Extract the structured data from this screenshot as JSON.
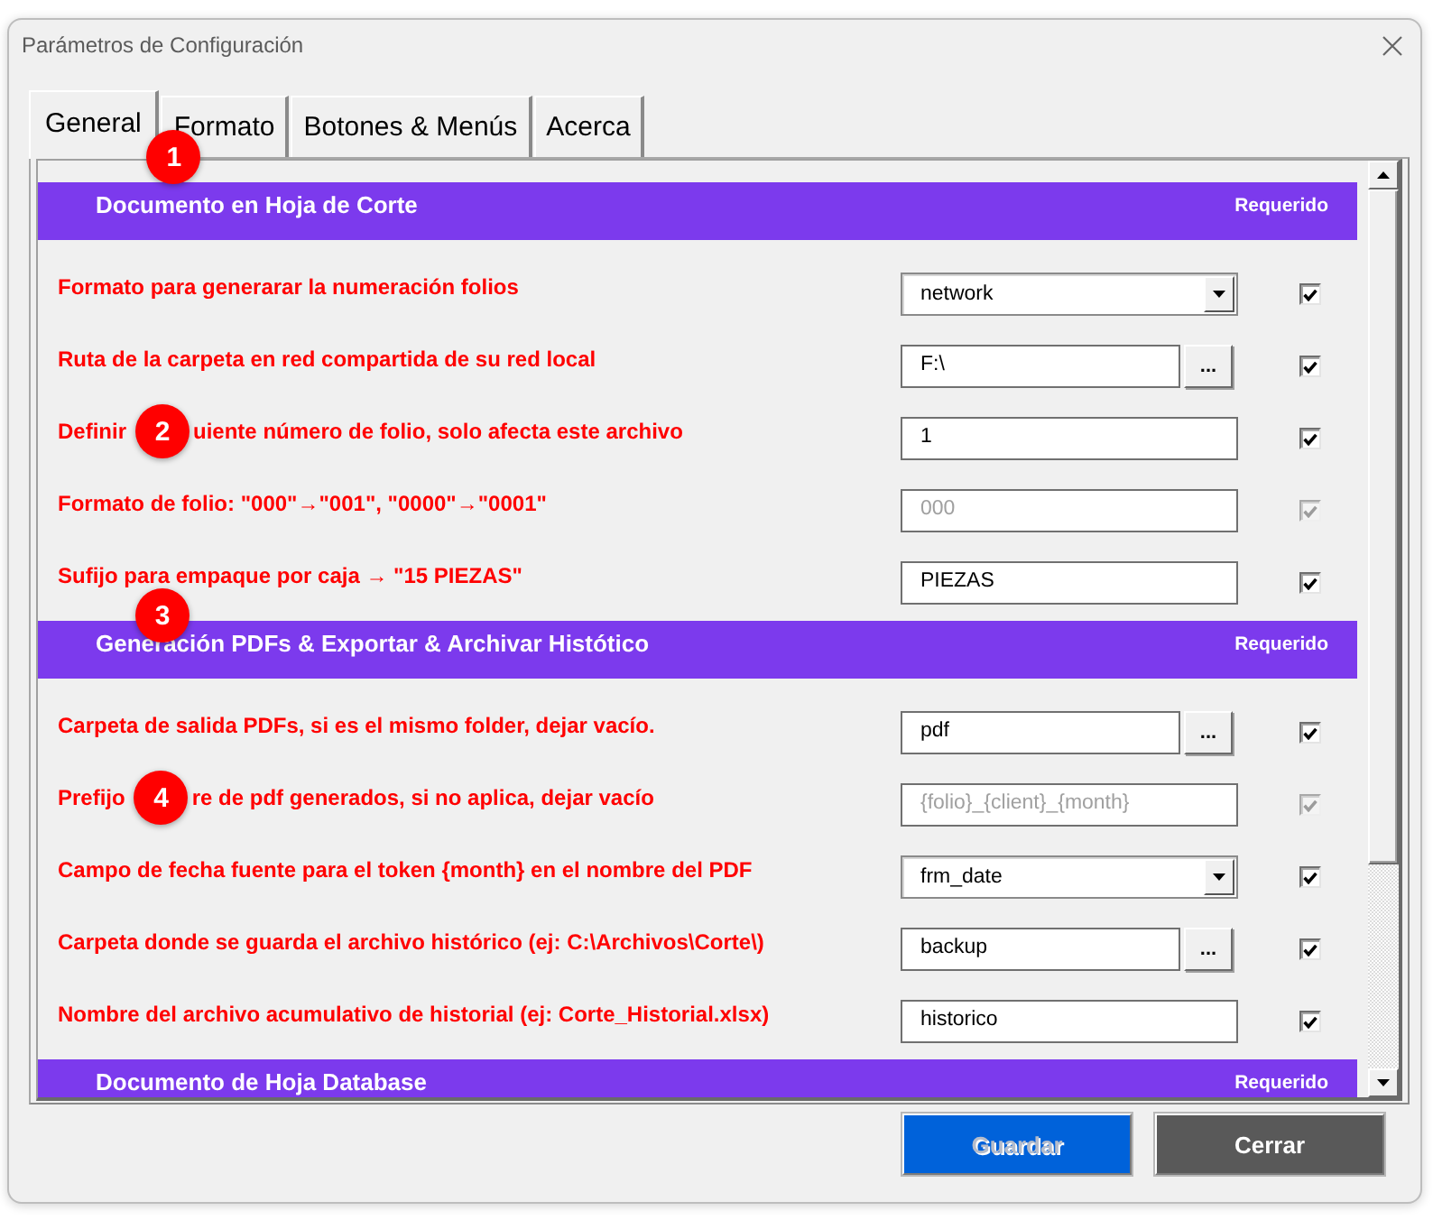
{
  "window": {
    "title": "Parámetros de Configuración"
  },
  "tabs": [
    {
      "label": "General",
      "selected": true,
      "callout": "1"
    },
    {
      "label": "Formato",
      "selected": false
    },
    {
      "label": "Botones & Menús",
      "selected": false
    },
    {
      "label": "Acerca",
      "selected": false
    }
  ],
  "sections": [
    {
      "title": "Documento en Hoja de Corte",
      "note": "Requerido",
      "rows": [
        {
          "kind": "dropdown",
          "label": "Formato para generarar la numeración folios",
          "value": "network",
          "disabled": false,
          "checked": true
        },
        {
          "kind": "browse",
          "label": "Ruta de la carpeta en red compartida de su red local",
          "value": "F:\\",
          "button": "...",
          "disabled": false,
          "checked": true
        },
        {
          "kind": "text",
          "label_parts": [
            "Definir",
            "uiente número de folio, solo afecta este archivo"
          ],
          "value": "1",
          "disabled": false,
          "checked": true,
          "callout": "2"
        },
        {
          "kind": "text",
          "label": "Formato de folio: \"000\"→\"001\", \"0000\"→\"0001\"",
          "value": "000",
          "disabled": true,
          "checked": true
        },
        {
          "kind": "text",
          "label": "Sufijo para empaque por caja → \"15 PIEZAS\"",
          "value": "PIEZAS",
          "disabled": false,
          "checked": true
        }
      ]
    },
    {
      "title": "Generación PDFs & Exportar & Archivar Histótico",
      "note": "Requerido",
      "callout": "3",
      "rows": [
        {
          "kind": "browse",
          "label": "Carpeta de salida PDFs, si es el mismo folder, dejar vacío.",
          "value": "pdf",
          "button": "...",
          "disabled": false,
          "checked": true
        },
        {
          "kind": "text",
          "label_parts": [
            "Prefijo",
            "re de pdf generados, si no aplica, dejar vacío"
          ],
          "value": "{folio}_{client}_{month}",
          "disabled": true,
          "checked": true,
          "callout": "4"
        },
        {
          "kind": "dropdown",
          "label": "Campo de fecha fuente para el token {month} en el nombre del PDF",
          "value": "frm_date",
          "disabled": false,
          "checked": true
        },
        {
          "kind": "browse",
          "label": "Carpeta donde se guarda el archivo histórico (ej: C:\\Archivos\\Corte\\)",
          "value": "backup",
          "button": "...",
          "disabled": false,
          "checked": true
        },
        {
          "kind": "text",
          "label": "Nombre del archivo acumulativo de historial (ej: Corte_Historial.xlsx)",
          "value": "historico",
          "disabled": false,
          "checked": true
        }
      ]
    },
    {
      "title": "Documento de Hoja Database",
      "note": "Requerido"
    }
  ],
  "buttons": [
    {
      "kind": "save",
      "label": "Guardar",
      "disabled": true
    },
    {
      "kind": "close",
      "label": "Cerrar",
      "disabled": false
    }
  ]
}
